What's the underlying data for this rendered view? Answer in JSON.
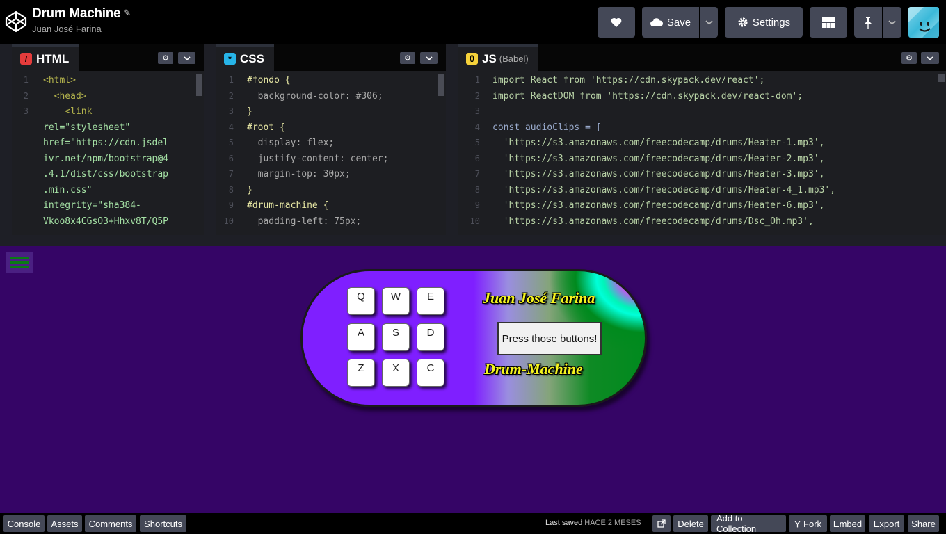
{
  "header": {
    "title": "Drum Machine",
    "author": "Juan José Farina",
    "heart_icon": "heart-icon",
    "save_label": "Save",
    "settings_label": "Settings"
  },
  "editors": {
    "html": {
      "tab_label": "HTML",
      "lines": [
        {
          "n": "1",
          "text": "<html>"
        },
        {
          "n": "2",
          "text": "  <head>"
        },
        {
          "n": "3",
          "text": "    <link"
        },
        {
          "n": "",
          "text": "rel=\"stylesheet\""
        },
        {
          "n": "",
          "text": "href=\"https://cdn.jsdel"
        },
        {
          "n": "",
          "text": "ivr.net/npm/bootstrap@4"
        },
        {
          "n": "",
          "text": ".4.1/dist/css/bootstrap"
        },
        {
          "n": "",
          "text": ".min.css\""
        },
        {
          "n": "",
          "text": "integrity=\"sha384-"
        },
        {
          "n": "",
          "text": "Vkoo8x4CGsO3+Hhxv8T/Q5P"
        }
      ]
    },
    "css": {
      "tab_label": "CSS",
      "lines": [
        {
          "n": "1",
          "text": "#fondo {"
        },
        {
          "n": "2",
          "text": "  background-color: #306;"
        },
        {
          "n": "3",
          "text": "}"
        },
        {
          "n": "4",
          "text": "#root {"
        },
        {
          "n": "5",
          "text": "  display: flex;"
        },
        {
          "n": "6",
          "text": "  justify-content: center;"
        },
        {
          "n": "7",
          "text": "  margin-top: 30px;"
        },
        {
          "n": "8",
          "text": "}"
        },
        {
          "n": "9",
          "text": "#drum-machine {"
        },
        {
          "n": "10",
          "text": "  padding-left: 75px;"
        }
      ]
    },
    "js": {
      "tab_label": "JS",
      "tab_sub": "(Babel)",
      "lines": [
        {
          "n": "1",
          "text": "import React from 'https://cdn.skypack.dev/react';"
        },
        {
          "n": "2",
          "text": "import ReactDOM from 'https://cdn.skypack.dev/react-dom';"
        },
        {
          "n": "3",
          "text": ""
        },
        {
          "n": "4",
          "text": "const audioClips = ["
        },
        {
          "n": "5",
          "text": "  'https://s3.amazonaws.com/freecodecamp/drums/Heater-1.mp3',"
        },
        {
          "n": "6",
          "text": "  'https://s3.amazonaws.com/freecodecamp/drums/Heater-2.mp3',"
        },
        {
          "n": "7",
          "text": "  'https://s3.amazonaws.com/freecodecamp/drums/Heater-3.mp3',"
        },
        {
          "n": "8",
          "text": "  'https://s3.amazonaws.com/freecodecamp/drums/Heater-4_1.mp3',"
        },
        {
          "n": "9",
          "text": "  'https://s3.amazonaws.com/freecodecamp/drums/Heater-6.mp3',"
        },
        {
          "n": "10",
          "text": "  'https://s3.amazonaws.com/freecodecamp/drums/Dsc_Oh.mp3',"
        }
      ]
    }
  },
  "preview": {
    "pads": [
      "Q",
      "W",
      "E",
      "A",
      "S",
      "D",
      "Z",
      "X",
      "C"
    ],
    "author_name": "Juan José Farina",
    "display_text": "Press those buttons!",
    "machine_title": "Drum-Machine",
    "colors": {
      "background": "#330066",
      "pad": "#ffffff",
      "title_text": "#f5f51e"
    }
  },
  "footer": {
    "console": "Console",
    "assets": "Assets",
    "comments": "Comments",
    "shortcuts": "Shortcuts",
    "last_saved_label": "Last saved",
    "last_saved_value": "HACE 2 MESES",
    "delete": "Delete",
    "add_to_collection": "Add to Collection",
    "fork": "Fork",
    "embed": "Embed",
    "export": "Export",
    "share": "Share"
  }
}
